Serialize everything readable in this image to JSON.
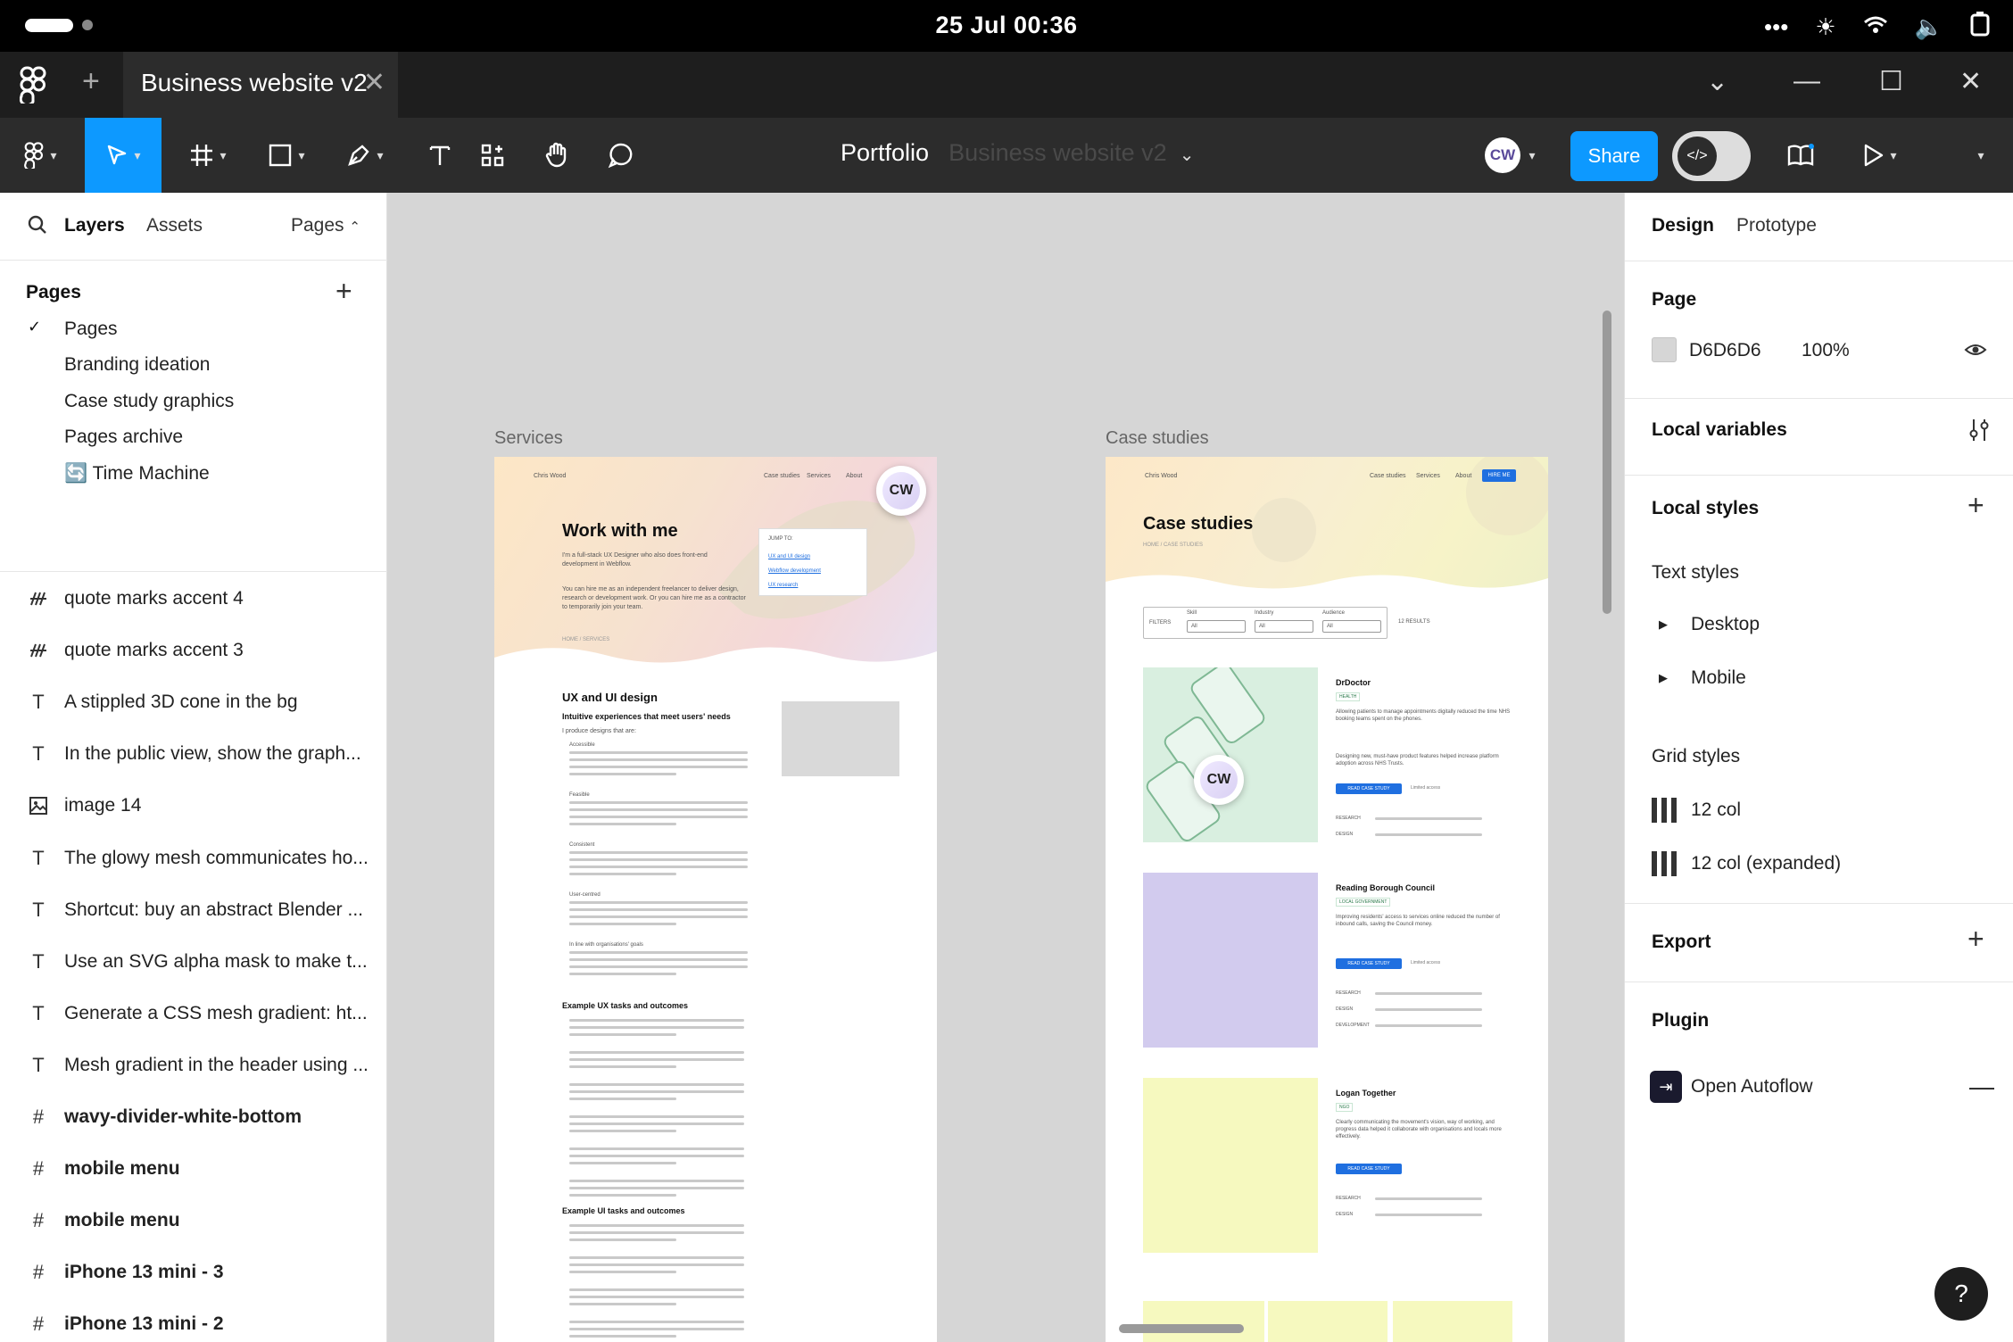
{
  "status_bar": {
    "time": "25 Jul  00:36",
    "more_icon": "more-dots-icon"
  },
  "tab_bar": {
    "tab_title": "Business website v2"
  },
  "toolbar": {
    "project": "Portfolio",
    "file_name_faded": "Business website v2",
    "avatar_initials": "CW",
    "share_label": "Share"
  },
  "left_panel": {
    "tabs": {
      "layers": "Layers",
      "assets": "Assets",
      "pages": "Pages"
    },
    "pages_heading": "Pages",
    "pages": [
      {
        "label": "Pages",
        "selected": true
      },
      {
        "label": "Branding ideation",
        "selected": false
      },
      {
        "label": "Case study graphics",
        "selected": false
      },
      {
        "label": "Pages archive",
        "selected": false
      },
      {
        "label": "🔄 Time Machine",
        "selected": false
      }
    ],
    "layers": [
      {
        "icon": "vector-icon",
        "label": "quote marks accent 4",
        "bold": false
      },
      {
        "icon": "vector-icon",
        "label": "quote marks accent 3",
        "bold": false
      },
      {
        "icon": "text-icon",
        "label": "A stippled 3D cone in the bg",
        "bold": false
      },
      {
        "icon": "text-icon",
        "label": "In the public view, show the graph...",
        "bold": false
      },
      {
        "icon": "image-icon",
        "label": "image 14",
        "bold": false
      },
      {
        "icon": "text-icon",
        "label": "The glowy mesh communicates ho...",
        "bold": false
      },
      {
        "icon": "text-icon",
        "label": "Shortcut: buy an abstract Blender ...",
        "bold": false
      },
      {
        "icon": "text-icon",
        "label": "Use an SVG alpha mask to make t...",
        "bold": false
      },
      {
        "icon": "text-icon",
        "label": "Generate a CSS mesh gradient:  ht...",
        "bold": false
      },
      {
        "icon": "text-icon",
        "label": "Mesh gradient in the header using ...",
        "bold": false
      },
      {
        "icon": "frame-icon",
        "label": "wavy-divider-white-bottom",
        "bold": true
      },
      {
        "icon": "frame-icon",
        "label": "mobile menu",
        "bold": true
      },
      {
        "icon": "frame-icon",
        "label": "mobile menu",
        "bold": true
      },
      {
        "icon": "frame-icon",
        "label": "iPhone 13 mini - 3",
        "bold": true
      },
      {
        "icon": "frame-icon",
        "label": "iPhone 13 mini - 2",
        "bold": true
      }
    ]
  },
  "right_panel": {
    "tabs": {
      "design": "Design",
      "prototype": "Prototype"
    },
    "page": {
      "heading": "Page",
      "color_hex": "D6D6D6",
      "opacity": "100%",
      "swatch_color": "#D6D6D6"
    },
    "local_variables": "Local variables",
    "local_styles": "Local styles",
    "text_styles": {
      "heading": "Text styles",
      "items": [
        "Desktop",
        "Mobile"
      ]
    },
    "grid_styles": {
      "heading": "Grid styles",
      "items": [
        "12 col",
        "12 col (expanded)"
      ]
    },
    "export": "Export",
    "plugin": {
      "heading": "Plugin",
      "name": "Open Autoflow"
    }
  },
  "canvas": {
    "services_frame": {
      "label": "Services",
      "brand": "Chris Wood",
      "nav": [
        "Case studies",
        "Services",
        "About"
      ],
      "hero_title": "Work with me",
      "hero_body": "I'm a full-stack UX Designer who also does front-end development in Webflow.",
      "hero_body2": "You can hire me as an independent freelancer to deliver design, research or development work. Or you can hire me as a contractor to temporarily join your team.",
      "breadcrumb": "HOME / SERVICES",
      "jump_heading": "JUMP TO:",
      "jump_links": [
        "UX and UI design",
        "Webflow development",
        "UX research"
      ],
      "section_title": "UX and UI design",
      "section_sub": "Intuitive experiences that meet users' needs",
      "section_intro": "I produce designs that are:",
      "bullets": [
        "Accessible",
        "Feasible",
        "Consistent",
        "User-centred",
        "In line with organisations' goals"
      ],
      "tasks_title": "Example UX tasks and outcomes",
      "ui_tasks_title": "Example UI tasks and outcomes"
    },
    "case_frame": {
      "label": "Case studies",
      "brand": "Chris Wood",
      "nav": [
        "Case studies",
        "Services",
        "About"
      ],
      "cta": "HIRE ME",
      "title": "Case studies",
      "breadcrumb": "HOME / CASE STUDIES",
      "filters_label": "FILTERS",
      "filter_fields": [
        {
          "label": "Skill",
          "value": "All"
        },
        {
          "label": "Industry",
          "value": "All"
        },
        {
          "label": "Audience",
          "value": "All"
        }
      ],
      "results": "12 RESULTS",
      "cards": [
        {
          "name": "DrDoctor",
          "tag": "HEALTH",
          "desc": "Allowing patients to manage appointments digitally reduced the time NHS booking teams spent on the phones.",
          "desc2": "Designing new, must-have product features helped increase platform adoption across NHS Trusts.",
          "btn": "READ CASE STUDY",
          "access": "Limited access",
          "color": "#d9efe0"
        },
        {
          "name": "Reading Borough Council",
          "tag": "LOCAL GOVERNMENT",
          "desc": "Improving residents' access to services online reduced the number of inbound calls, saving the Council money.",
          "desc2": "",
          "btn": "READ CASE STUDY",
          "access": "Limited access",
          "color": "#d2cbee"
        },
        {
          "name": "Logan Together",
          "tag": "NGO",
          "desc": "Clearly communicating the movement's vision, way of working, and progress data helped it collaborate with organisations and locals more effectively.",
          "desc2": "",
          "btn": "READ CASE STUDY",
          "access": "",
          "color": "#f6f9bf"
        }
      ],
      "row_labels": [
        "RESEARCH",
        "DESIGN",
        "DEVELOPMENT"
      ]
    },
    "cursor_initials": "CW"
  },
  "help": "?"
}
